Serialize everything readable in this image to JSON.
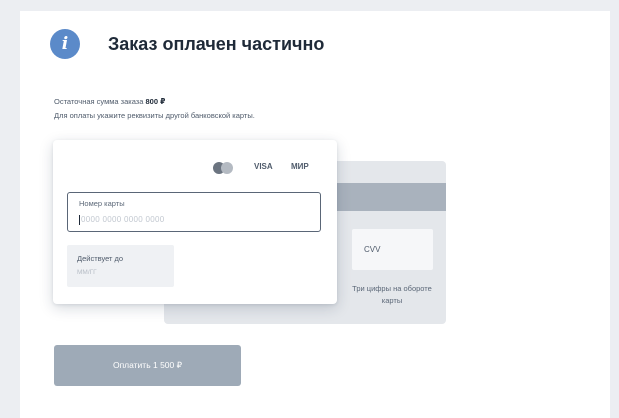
{
  "header": {
    "title": "Заказ оплачен частично",
    "info_icon": "info-icon",
    "info_glyph": "i"
  },
  "notice": {
    "remaining_label": "Остаточная сумма заказа",
    "remaining_amount": "800 ₽",
    "instruction": "Для оплаты укажите реквизиты другой банковской карты."
  },
  "card_front": {
    "brands": {
      "mastercard_icon": "mastercard-icon",
      "visa": "VISA",
      "mir": "МИР"
    },
    "number_label": "Номер карты",
    "number_placeholder": "0000 0000 0000 0000",
    "expiry_label": "Действует до",
    "expiry_placeholder": "ММ/ГГ"
  },
  "card_back": {
    "cvv_label": "CVV",
    "cvv_hint": "Три цифры на обороте карты"
  },
  "actions": {
    "pay_label": "Оплатить 1 500 ₽"
  },
  "colors": {
    "accent": "#5b8ac9",
    "button_disabled": "#9eaab7",
    "stripe": "#a9b2bd"
  }
}
